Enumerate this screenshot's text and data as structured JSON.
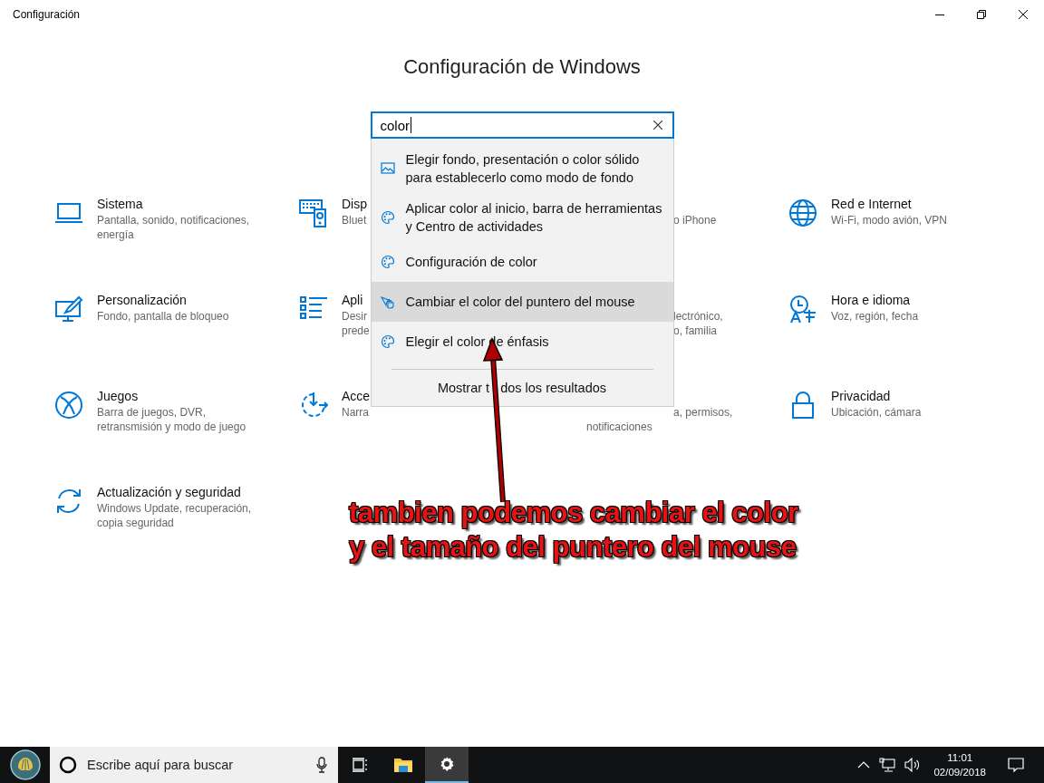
{
  "window": {
    "title": "Configuración"
  },
  "heading": "Configuración de Windows",
  "search": {
    "value": "color"
  },
  "results": [
    {
      "kind": "picture",
      "text": "Elegir fondo, presentación o color sólido para establecerlo como modo de fondo",
      "selected": false
    },
    {
      "kind": "palette",
      "text": "Aplicar color al inicio, barra de herramientas y Centro de actividades",
      "selected": false
    },
    {
      "kind": "palette",
      "text": "Configuración de color",
      "selected": false
    },
    {
      "kind": "pointer",
      "text": "Cambiar el color del puntero del mouse",
      "selected": true
    },
    {
      "kind": "palette",
      "text": "Elegir el color de énfasis",
      "selected": false
    }
  ],
  "show_all": [
    "Mostrar t",
    "dos los resultados"
  ],
  "categories": [
    {
      "title": "Sistema",
      "lines": [
        {
          "text": "Pantalla, sonido, notificaciones,",
          "cut": false
        },
        {
          "text": "energía",
          "cut": false
        }
      ]
    },
    {
      "title": "Disp",
      "lines": [
        {
          "text": "Bluet",
          "cut": false
        }
      ]
    },
    {
      "lines": [
        {
          "text": "o iPhone",
          "cut": true
        }
      ]
    },
    {
      "title": "Red e Internet",
      "lines": [
        {
          "text": "Wi-Fi, modo avión, VPN",
          "cut": false
        }
      ]
    },
    {
      "title": "Personalización",
      "lines": [
        {
          "text": "Fondo, pantalla de bloqueo",
          "cut": false
        }
      ]
    },
    {
      "title": "Apli",
      "lines": [
        {
          "text": "Desir",
          "cut": false
        },
        {
          "text": "prede",
          "cut": false
        }
      ]
    },
    {
      "lines": [
        {
          "text": "lectrónico,",
          "cut": true
        },
        {
          "text": "o, familia",
          "cut": true
        }
      ]
    },
    {
      "title": "Hora e idioma",
      "lines": [
        {
          "text": "Voz, región, fecha",
          "cut": false
        }
      ]
    },
    {
      "title": "Juegos",
      "lines": [
        {
          "text": "Barra de juegos, DVR,",
          "cut": false
        },
        {
          "text": "retransmisión y modo de juego",
          "cut": false
        }
      ]
    },
    {
      "title": "Acce",
      "lines": [
        {
          "text": "Narra",
          "cut": false
        }
      ]
    },
    {
      "lines": [
        {
          "text": "a, permisos,",
          "cut": true
        },
        {
          "text": "notificaciones",
          "cut": false
        }
      ]
    },
    {
      "title": "Privacidad",
      "lines": [
        {
          "text": "Ubicación, cámara",
          "cut": false
        }
      ]
    },
    {
      "title": "Actualización y seguridad",
      "lines": [
        {
          "text": "Windows Update, recuperación,",
          "cut": false
        },
        {
          "text": "copia seguridad",
          "cut": false
        }
      ]
    }
  ],
  "annotation": {
    "lines": [
      "tambien podemos cambiar el color",
      "y el tamaño del puntero del mouse"
    ]
  },
  "taskbar": {
    "search_placeholder": "Escribe aquí para buscar",
    "apps": [
      {
        "kind": "taskview",
        "active": false
      },
      {
        "kind": "folder",
        "active": false
      },
      {
        "kind": "gear",
        "active": true
      }
    ],
    "time": "11:01",
    "date": "02/09/2018"
  }
}
